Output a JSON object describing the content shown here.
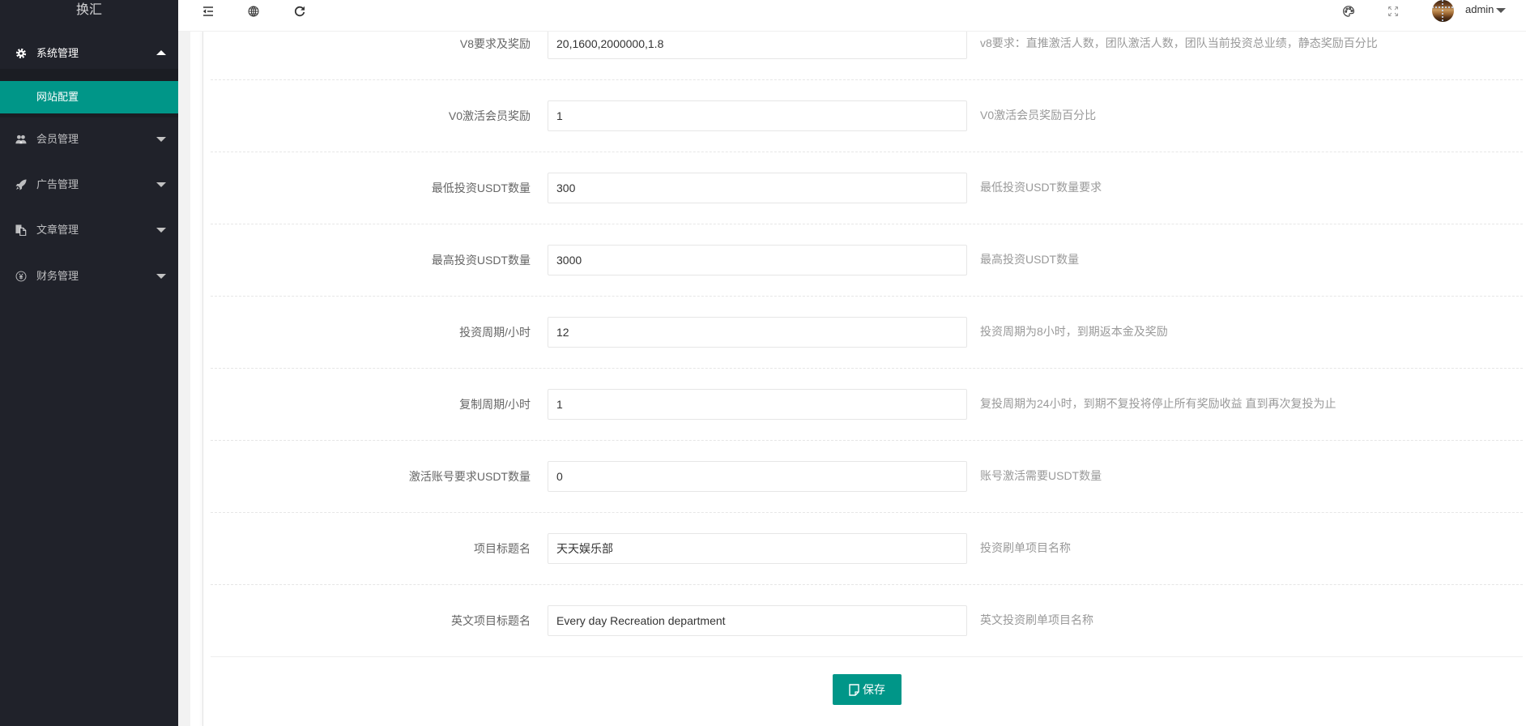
{
  "app": {
    "logo": "换汇"
  },
  "sidebar": {
    "items": [
      {
        "label": "系统管理",
        "icon": "gear-icon",
        "expanded": true,
        "children": [
          {
            "label": "网站配置",
            "active": true
          }
        ]
      },
      {
        "label": "会员管理",
        "icon": "users-icon",
        "expanded": false
      },
      {
        "label": "广告管理",
        "icon": "rocket-icon",
        "expanded": false
      },
      {
        "label": "文章管理",
        "icon": "copy-icon",
        "expanded": false
      },
      {
        "label": "财务管理",
        "icon": "yen-icon",
        "expanded": false
      }
    ]
  },
  "header": {
    "left_icons": [
      "shrink-menu-icon",
      "globe-icon",
      "refresh-icon"
    ],
    "right_icons": [
      "theme-palette-icon",
      "fullscreen-icon"
    ],
    "user": "admin"
  },
  "form": {
    "fields": [
      {
        "label": "V8要求及奖励",
        "value": "20,1600,2000000,1.8",
        "hint": "v8要求：直推激活人数，团队激活人数，团队当前投资总业绩，静态奖励百分比"
      },
      {
        "label": "V0激活会员奖励",
        "value": "1",
        "hint": "V0激活会员奖励百分比"
      },
      {
        "label": "最低投资USDT数量",
        "value": "300",
        "hint": "最低投资USDT数量要求"
      },
      {
        "label": "最高投资USDT数量",
        "value": "3000",
        "hint": "最高投资USDT数量"
      },
      {
        "label": "投资周期/小时",
        "value": "12",
        "hint": "投资周期为8小时，到期返本金及奖励"
      },
      {
        "label": "复制周期/小时",
        "value": "1",
        "hint": "复投周期为24小时，到期不复投将停止所有奖励收益 直到再次复投为止"
      },
      {
        "label": "激活账号要求USDT数量",
        "value": "0",
        "hint": "账号激活需要USDT数量"
      },
      {
        "label": "项目标题名",
        "value": "天天娱乐部",
        "hint": "投资刷单项目名称"
      },
      {
        "label": "英文项目标题名",
        "value": "Every day Recreation department",
        "hint": "英文投资刷单项目名称"
      }
    ],
    "save_label": "保存"
  },
  "colors": {
    "accent": "#009688",
    "sidebar_bg": "#20222a",
    "hint_text": "#999999"
  }
}
